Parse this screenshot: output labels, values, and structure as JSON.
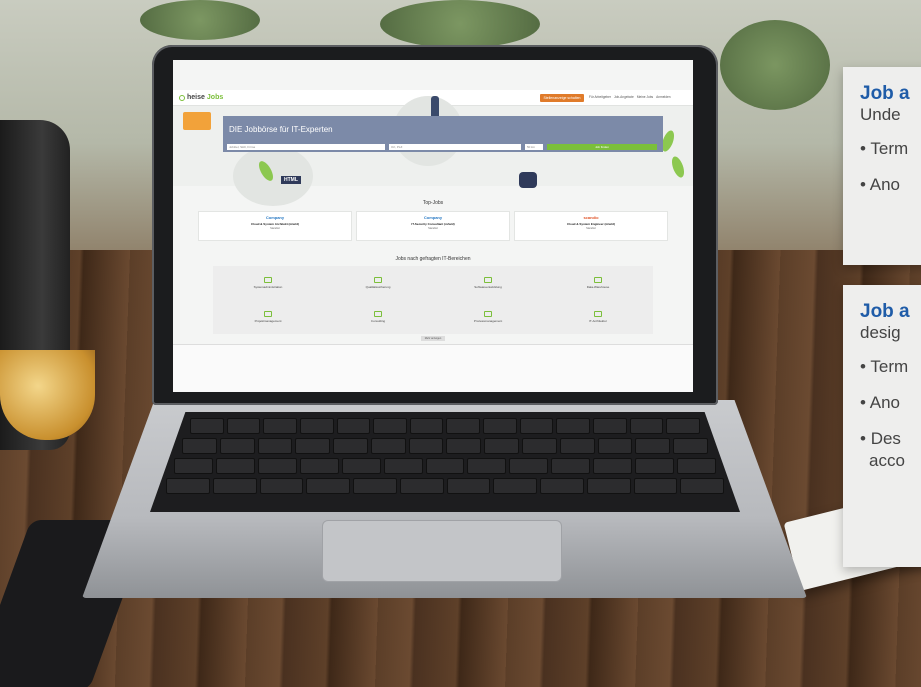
{
  "site": {
    "logo": "heise",
    "logo_accent": "Jobs",
    "header_button": "Stellenanzeige schalten",
    "header_links": [
      "Für Arbeitgeber",
      "Job-Angebote",
      "Meine Jobs",
      "Anmelden"
    ],
    "hero_title": "DIE Jobbörse für IT-Experten",
    "search_placeholder": "Jobtitel, Skill, Firma",
    "location_placeholder": "Ort, PLZ",
    "radius_value": "50 km",
    "search_button": "Job finden",
    "hero_badge": "HTML",
    "top_jobs_title": "Top-Jobs",
    "top_jobs": [
      {
        "company": "Company",
        "title": "Cloud & System Architekt (m/w/d)",
        "location": "Standort"
      },
      {
        "company": "Company",
        "title": "IT-Security Consultant (m/w/d)",
        "location": "Standort"
      },
      {
        "company": "scandio",
        "title": "Cloud & System Engineer (m/w/d)",
        "location": "Standort"
      }
    ],
    "categories_title": "Jobs nach gefragten IT-Bereichen",
    "categories": [
      "Systemadministration",
      "Qualitätssicherung",
      "Softwareentwicklung",
      "Data-Warehouse",
      "Projektmanagement",
      "Consulting",
      "Prozessmanagement",
      "IT-Architektur"
    ],
    "more_button": "Mehr anzeigen"
  },
  "cards": [
    {
      "title": "Job a",
      "subtitle": "Unde",
      "bullets": [
        "Term",
        "Ano"
      ]
    },
    {
      "title": "Job a",
      "subtitle": "desig",
      "bullets": [
        "Term",
        "Ano",
        "Des"
      ],
      "bullet3_cont": "acco"
    }
  ],
  "colors": {
    "accent_green": "#7bbf3a",
    "card_title_blue": "#1f5ca8",
    "header_orange": "#e07b2a",
    "hero_blue": "#7c8aa8"
  }
}
